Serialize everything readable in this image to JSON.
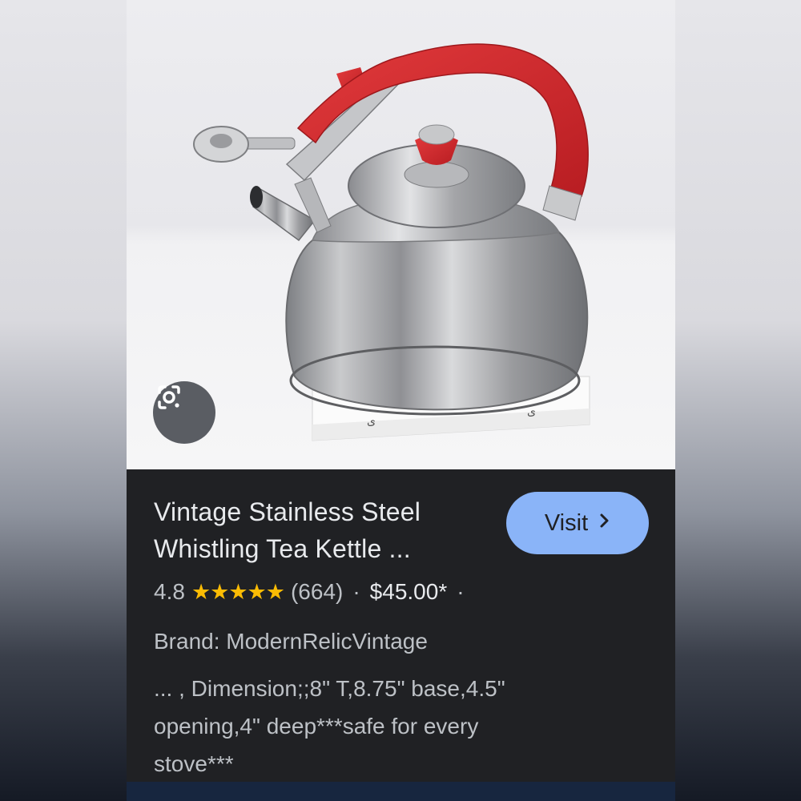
{
  "result": {
    "title_lines": [
      "Vintage Stainless Steel",
      "Whistling Tea Kettle ..."
    ],
    "visit_label": "Visit",
    "rating": "4.8",
    "stars": "★★★★★",
    "review_count": "(664)",
    "separator": "·",
    "price": "$45.00*",
    "trailing_separator": "·",
    "brand": "Brand: ModernRelicVintage",
    "description_lines": [
      "... , Dimension;;8\" T,8.75\" base,4.5\"",
      "opening,4\" deep***safe for every",
      "stove***"
    ]
  },
  "icons": {
    "lens": "google-lens-icon",
    "visit_chevron": "chevron-right-icon"
  },
  "colors": {
    "card_background": "#202124",
    "visit_button": "#8ab4f8",
    "star": "#fbbc04",
    "kettle_handle": "#d8262b"
  }
}
